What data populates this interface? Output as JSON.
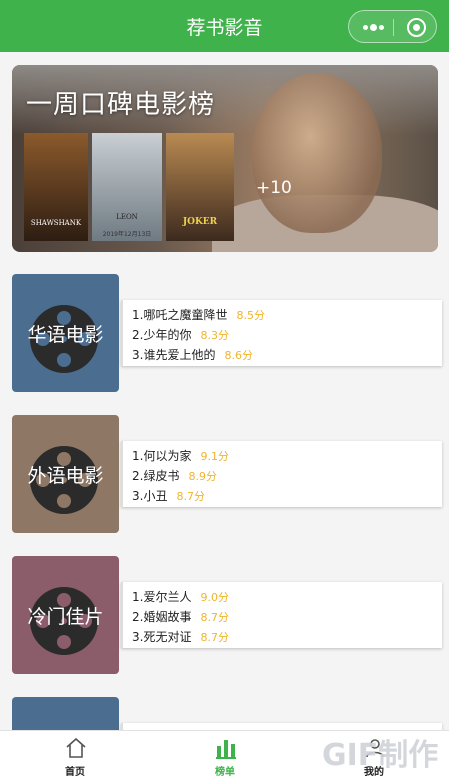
{
  "navbar": {
    "title": "荐书影音"
  },
  "banner": {
    "title": "一周口碑电影榜",
    "more_count": "+10",
    "posters": [
      {
        "text": "SHAWSHANK",
        "date": ""
      },
      {
        "text": "LEON",
        "date": "2019年12月13日"
      },
      {
        "text": "JOKER",
        "date": ""
      }
    ]
  },
  "categories": [
    {
      "name": "华语电影",
      "color": "#4b6e90",
      "items": [
        {
          "title": "1.哪吒之魔童降世",
          "score": "8.5分"
        },
        {
          "title": "2.少年的你",
          "score": "8.3分"
        },
        {
          "title": "3.谁先爱上他的",
          "score": "8.6分"
        }
      ]
    },
    {
      "name": "外语电影",
      "color": "#8e7764",
      "items": [
        {
          "title": "1.何以为家",
          "score": "9.1分"
        },
        {
          "title": "2.绿皮书",
          "score": "8.9分"
        },
        {
          "title": "3.小丑",
          "score": "8.7分"
        }
      ]
    },
    {
      "name": "冷门佳片",
      "color": "#8b5c6a",
      "items": [
        {
          "title": "1.爱尔兰人",
          "score": "9.0分"
        },
        {
          "title": "2.婚姻故事",
          "score": "8.7分"
        },
        {
          "title": "3.死无对证",
          "score": "8.7分"
        }
      ]
    },
    {
      "color": "#4b6e90"
    }
  ],
  "tabbar": {
    "tabs": [
      {
        "label": "首页",
        "icon": "home-icon"
      },
      {
        "label": "榜单",
        "icon": "chart-icon"
      },
      {
        "label": "我的",
        "icon": "user-icon"
      }
    ],
    "active_color": "#3fb24c"
  },
  "watermark": {
    "text": "GIF制作"
  }
}
